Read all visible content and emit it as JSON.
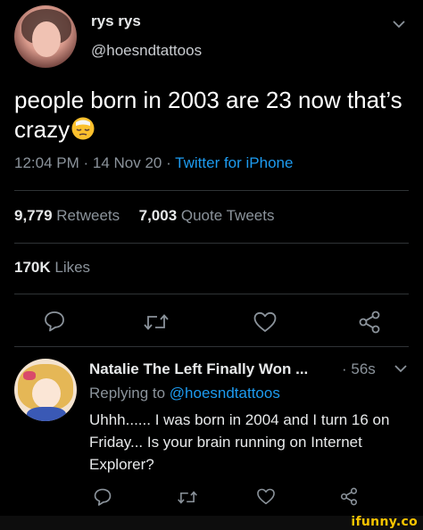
{
  "tweet": {
    "author_name": "rys rys",
    "author_handle": "@hoesndtattoos",
    "text": "people born in 2003 are 23 now that’s crazy",
    "time": "12:04 PM · 14 Nov 20 · ",
    "source": "Twitter for iPhone",
    "retweets_count": "9,779",
    "retweets_label": " Retweets",
    "quotes_count": "7,003",
    "quotes_label": " Quote Tweets",
    "likes_count": "170K",
    "likes_label": " Likes"
  },
  "reply": {
    "author_name": "Natalie The Left Finally Won ...",
    "time": "· 56s",
    "replying_prefix": "Replying to ",
    "replying_handle": "@hoesndtattoos",
    "text": "Uhhh...... I was born in 2004 and I turn 16 on Friday... Is your brain running on Internet Explorer?"
  },
  "icons": {
    "reply": "speech-bubble-icon",
    "retweet": "retweet-icon",
    "like": "heart-icon",
    "share": "share-icon",
    "more": "chevron-down-icon"
  },
  "colors": {
    "background": "#000000",
    "link": "#1d9bf0",
    "muted": "#8b939b",
    "brand": "#f8c400"
  },
  "watermark": "ifunny.co"
}
